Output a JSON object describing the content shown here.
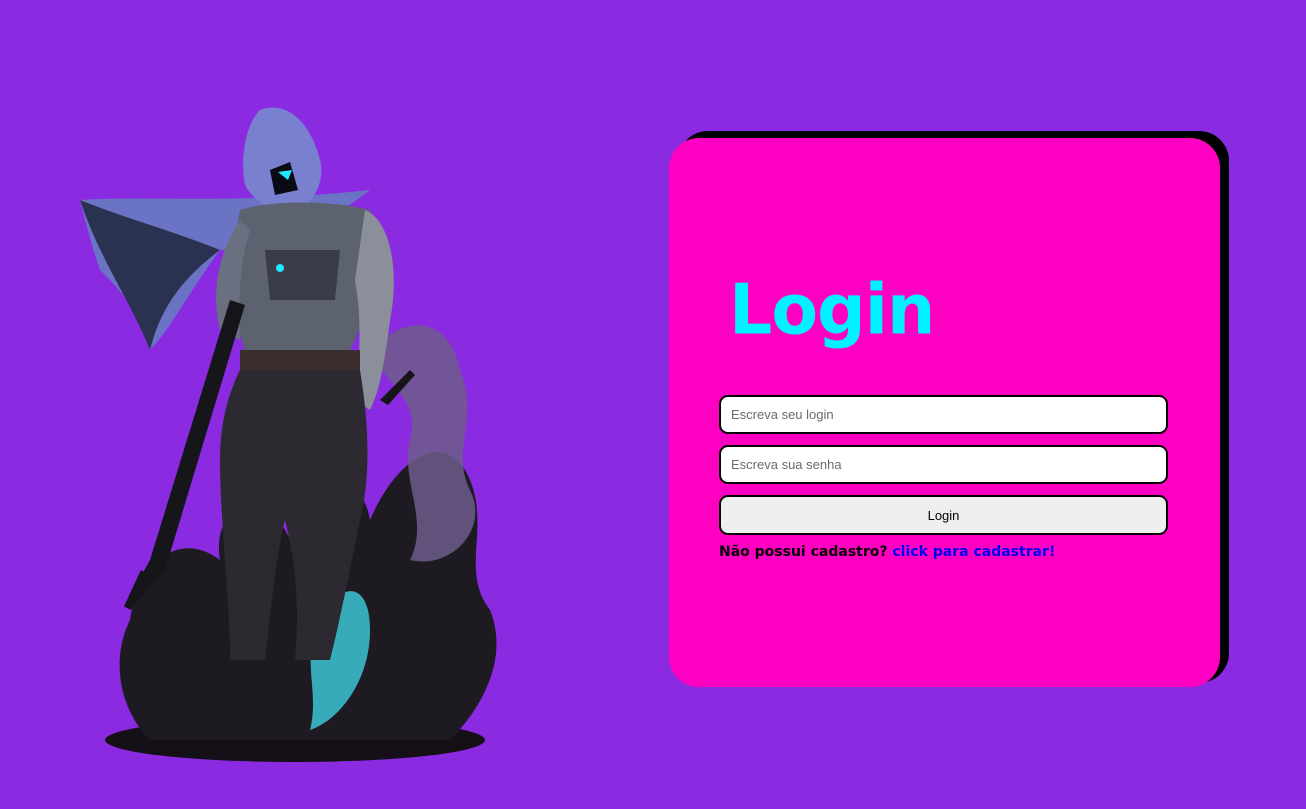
{
  "login_card": {
    "title": "Login",
    "username_placeholder": "Escreva seu login",
    "password_placeholder": "Escreva sua senha",
    "submit_label": "Login",
    "signup_prompt": "Não possui cadastro?",
    "signup_link": "click para cadastrar!"
  },
  "hero_image": {
    "subject": "hooded armored soldier with rifle in dark smoke"
  },
  "colors": {
    "background": "#8a2be2",
    "card": "#ff00c3",
    "card_shadow": "#000000",
    "title": "#00f2ff",
    "link": "#0000ee",
    "button": "#efefef"
  }
}
